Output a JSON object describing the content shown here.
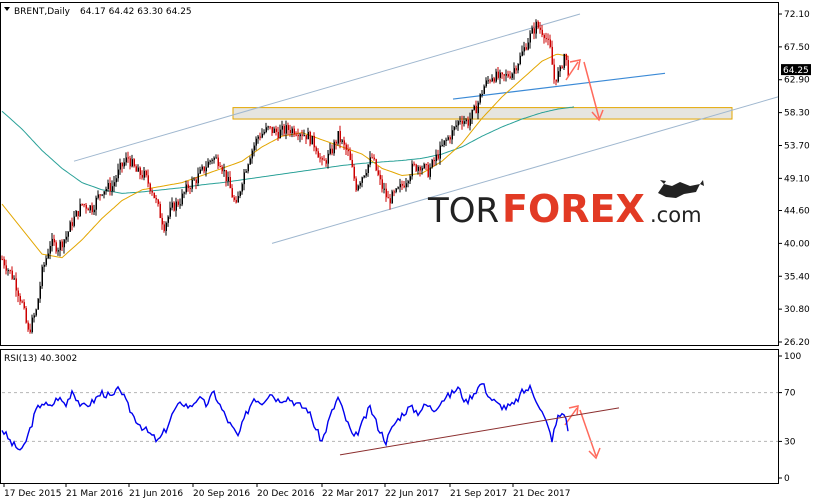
{
  "header": {
    "symbol_label": "BRENT,Daily",
    "ohlc_text": "64.17 64.42 63.30 64.25",
    "rsi_label": "RSI(13) 40.3002"
  },
  "logo": {
    "part1": "TOR",
    "part2": "FOREX",
    "part3": ".com"
  },
  "price_badge": "64.25",
  "colors": {
    "candle_up": "#000000",
    "candle_down": "#cc0000",
    "ma_fast": "#e3a600",
    "ma_slow": "#2aa198",
    "channel": "#9fb7cf",
    "trendline_blue": "#3b8ad6",
    "rsi_line": "#0000ee",
    "rsi_trend": "#8b2e2e",
    "arrow": "#ff6a5c",
    "zone_fill": "#e2e0d9",
    "zone_border": "#e3a600"
  },
  "chart_data": [
    {
      "type": "candlestick",
      "title": "BRENT,Daily",
      "ylim": [
        26.2,
        72.1
      ],
      "y_ticks": [
        "72.10",
        "67.50",
        "62.90",
        "58.30",
        "53.70",
        "49.10",
        "44.60",
        "40.00",
        "35.40",
        "30.80",
        "26.20"
      ],
      "x_ticks": [
        "17 Dec 2015",
        "21 Mar 2016",
        "21 Jun 2016",
        "20 Sep 2016",
        "20 Dec 2016",
        "22 Mar 2017",
        "22 Jun 2017",
        "21 Sep 2017",
        "21 Dec 2017"
      ],
      "last_price": 64.25,
      "price_path": [
        [
          0,
          37.8
        ],
        [
          12,
          35.0
        ],
        [
          20,
          31.5
        ],
        [
          26,
          27.5
        ],
        [
          34,
          30.5
        ],
        [
          40,
          36.0
        ],
        [
          48,
          40.0
        ],
        [
          56,
          39.5
        ],
        [
          64,
          41.0
        ],
        [
          70,
          43.0
        ],
        [
          80,
          45.5
        ],
        [
          90,
          45.0
        ],
        [
          100,
          47.5
        ],
        [
          110,
          48.0
        ],
        [
          118,
          50.5
        ],
        [
          126,
          52.0
        ],
        [
          134,
          50.0
        ],
        [
          142,
          49.5
        ],
        [
          150,
          47.5
        ],
        [
          158,
          44.0
        ],
        [
          162,
          42.5
        ],
        [
          170,
          45.0
        ],
        [
          178,
          46.0
        ],
        [
          186,
          48.0
        ],
        [
          194,
          49.0
        ],
        [
          202,
          50.5
        ],
        [
          210,
          52.0
        ],
        [
          218,
          51.5
        ],
        [
          226,
          48.5
        ],
        [
          234,
          45.0
        ],
        [
          240,
          49.0
        ],
        [
          248,
          52.5
        ],
        [
          256,
          55.0
        ],
        [
          266,
          56.0
        ],
        [
          276,
          55.5
        ],
        [
          286,
          56.0
        ],
        [
          296,
          55.8
        ],
        [
          306,
          55.0
        ],
        [
          314,
          53.5
        ],
        [
          320,
          51.0
        ],
        [
          328,
          52.5
        ],
        [
          336,
          55.0
        ],
        [
          346,
          52.5
        ],
        [
          354,
          48.0
        ],
        [
          362,
          50.0
        ],
        [
          370,
          52.0
        ],
        [
          378,
          48.5
        ],
        [
          386,
          46.0
        ],
        [
          394,
          47.0
        ],
        [
          402,
          48.5
        ],
        [
          410,
          50.5
        ],
        [
          418,
          51.0
        ],
        [
          426,
          50.0
        ],
        [
          434,
          52.0
        ],
        [
          442,
          54.0
        ],
        [
          450,
          55.5
        ],
        [
          458,
          57.5
        ],
        [
          466,
          57.0
        ],
        [
          474,
          59.0
        ],
        [
          482,
          62.0
        ],
        [
          490,
          63.5
        ],
        [
          500,
          63.0
        ],
        [
          510,
          64.0
        ],
        [
          518,
          66.0
        ],
        [
          526,
          68.5
        ],
        [
          534,
          70.5
        ],
        [
          542,
          69.5
        ],
        [
          548,
          67.0
        ],
        [
          552,
          63.0
        ],
        [
          558,
          64.0
        ],
        [
          562,
          66.5
        ],
        [
          566,
          64.2
        ]
      ],
      "ma_fast_path": [
        [
          0,
          45.5
        ],
        [
          20,
          42.0
        ],
        [
          40,
          38.5
        ],
        [
          60,
          38.0
        ],
        [
          80,
          40.5
        ],
        [
          100,
          43.5
        ],
        [
          120,
          46.0
        ],
        [
          140,
          47.5
        ],
        [
          160,
          48.0
        ],
        [
          180,
          48.5
        ],
        [
          200,
          49.5
        ],
        [
          220,
          50.5
        ],
        [
          240,
          51.5
        ],
        [
          260,
          53.5
        ],
        [
          280,
          55.0
        ],
        [
          300,
          55.5
        ],
        [
          320,
          54.5
        ],
        [
          340,
          53.5
        ],
        [
          360,
          52.5
        ],
        [
          380,
          50.5
        ],
        [
          400,
          49.5
        ],
        [
          420,
          49.8
        ],
        [
          440,
          51.5
        ],
        [
          460,
          54.0
        ],
        [
          480,
          57.5
        ],
        [
          500,
          60.5
        ],
        [
          520,
          63.0
        ],
        [
          540,
          65.5
        ],
        [
          555,
          66.5
        ],
        [
          566,
          66.2
        ]
      ],
      "ma_slow_path": [
        [
          0,
          58.5
        ],
        [
          20,
          56.0
        ],
        [
          40,
          53.0
        ],
        [
          60,
          50.5
        ],
        [
          80,
          48.5
        ],
        [
          100,
          47.5
        ],
        [
          120,
          47.0
        ],
        [
          140,
          47.2
        ],
        [
          160,
          47.5
        ],
        [
          180,
          47.8
        ],
        [
          200,
          48.2
        ],
        [
          220,
          48.5
        ],
        [
          240,
          48.9
        ],
        [
          260,
          49.3
        ],
        [
          280,
          49.7
        ],
        [
          300,
          50.1
        ],
        [
          320,
          50.5
        ],
        [
          340,
          50.9
        ],
        [
          360,
          51.2
        ],
        [
          380,
          51.4
        ],
        [
          400,
          51.6
        ],
        [
          420,
          51.9
        ],
        [
          440,
          52.5
        ],
        [
          460,
          53.5
        ],
        [
          480,
          55.0
        ],
        [
          500,
          56.3
        ],
        [
          520,
          57.4
        ],
        [
          540,
          58.3
        ],
        [
          556,
          58.8
        ],
        [
          572,
          59.1
        ]
      ],
      "channel_upper": [
        [
          72,
          51.5
        ],
        [
          578,
          72.1
        ]
      ],
      "channel_lower": [
        [
          270,
          40.0
        ],
        [
          776,
          60.5
        ]
      ],
      "trend_upper_short": [
        [
          451,
          60.2
        ],
        [
          663,
          63.8
        ]
      ],
      "resistance_zone": [
        57.4,
        59.0
      ],
      "resistance_zone_x": [
        233,
        732
      ]
    },
    {
      "type": "line",
      "title": "RSI(13) 40.3002",
      "ylim": [
        0,
        100
      ],
      "y_ticks": [
        "100",
        "70",
        "30",
        "0"
      ],
      "levels": [
        30,
        70
      ],
      "last_value": 40.3,
      "rsi_path": [
        [
          0,
          40
        ],
        [
          10,
          28
        ],
        [
          20,
          22
        ],
        [
          26,
          35
        ],
        [
          34,
          55
        ],
        [
          40,
          62
        ],
        [
          48,
          58
        ],
        [
          56,
          66
        ],
        [
          64,
          60
        ],
        [
          70,
          72
        ],
        [
          80,
          58
        ],
        [
          90,
          62
        ],
        [
          100,
          70
        ],
        [
          110,
          66
        ],
        [
          118,
          74
        ],
        [
          124,
          62
        ],
        [
          132,
          50
        ],
        [
          140,
          42
        ],
        [
          148,
          36
        ],
        [
          156,
          30
        ],
        [
          164,
          40
        ],
        [
          172,
          55
        ],
        [
          180,
          62
        ],
        [
          188,
          58
        ],
        [
          196,
          66
        ],
        [
          204,
          60
        ],
        [
          212,
          70
        ],
        [
          220,
          56
        ],
        [
          228,
          44
        ],
        [
          236,
          34
        ],
        [
          244,
          52
        ],
        [
          252,
          66
        ],
        [
          260,
          62
        ],
        [
          268,
          70
        ],
        [
          276,
          64
        ],
        [
          286,
          66
        ],
        [
          296,
          60
        ],
        [
          306,
          56
        ],
        [
          314,
          40
        ],
        [
          320,
          30
        ],
        [
          328,
          50
        ],
        [
          336,
          66
        ],
        [
          344,
          48
        ],
        [
          352,
          32
        ],
        [
          360,
          44
        ],
        [
          368,
          58
        ],
        [
          376,
          42
        ],
        [
          384,
          30
        ],
        [
          392,
          44
        ],
        [
          400,
          52
        ],
        [
          408,
          58
        ],
        [
          416,
          54
        ],
        [
          424,
          60
        ],
        [
          432,
          56
        ],
        [
          440,
          64
        ],
        [
          448,
          68
        ],
        [
          456,
          74
        ],
        [
          464,
          62
        ],
        [
          472,
          70
        ],
        [
          480,
          78
        ],
        [
          488,
          66
        ],
        [
          496,
          60
        ],
        [
          504,
          58
        ],
        [
          512,
          60
        ],
        [
          520,
          70
        ],
        [
          528,
          74
        ],
        [
          536,
          62
        ],
        [
          544,
          46
        ],
        [
          550,
          32
        ],
        [
          556,
          50
        ],
        [
          562,
          54
        ],
        [
          566,
          40
        ]
      ],
      "rsi_trendline": [
        [
          338,
          19
        ],
        [
          617,
          57.5
        ]
      ]
    }
  ]
}
